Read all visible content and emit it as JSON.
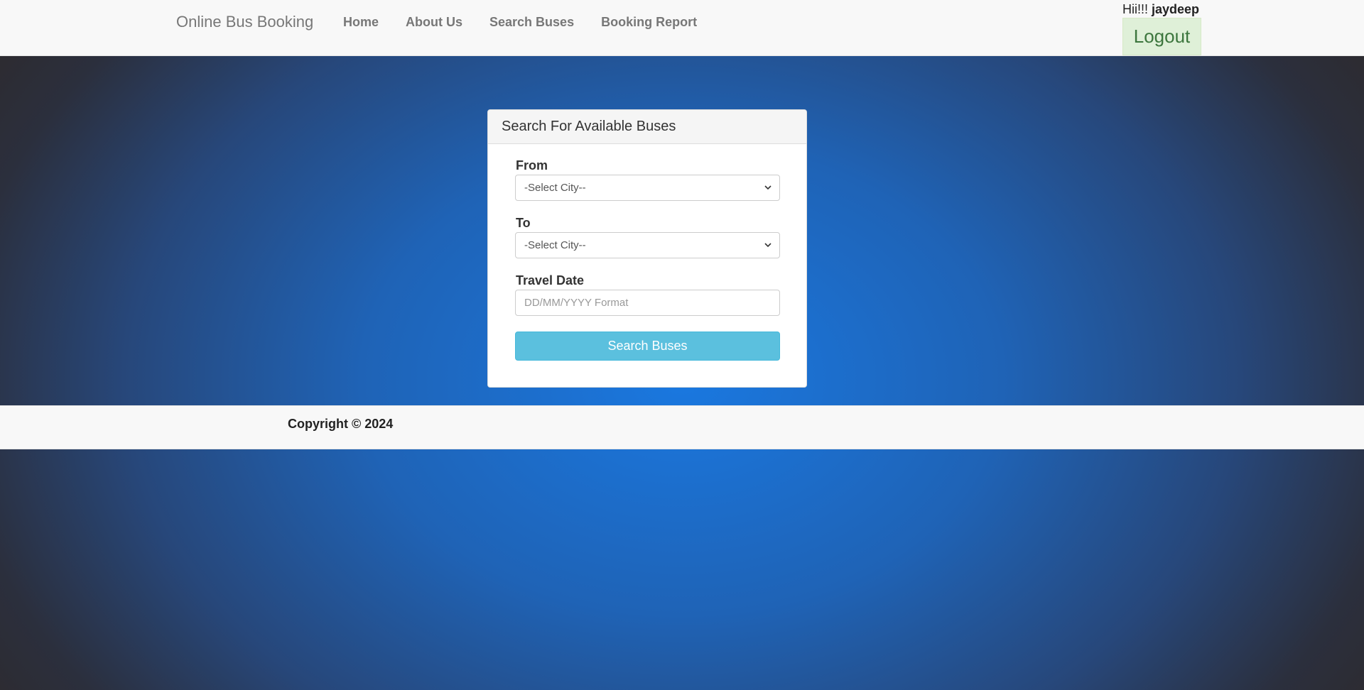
{
  "navbar": {
    "brand": "Online Bus Booking",
    "links": [
      {
        "label": "Home"
      },
      {
        "label": "About Us"
      },
      {
        "label": "Search Buses"
      },
      {
        "label": "Booking Report"
      }
    ],
    "greeting_prefix": "Hii!!! ",
    "username": "jaydeep",
    "logout_label": "Logout"
  },
  "search_panel": {
    "title": "Search For Available Buses",
    "from_label": "From",
    "from_value": "-Select City--",
    "to_label": "To",
    "to_value": "-Select City--",
    "date_label": "Travel Date",
    "date_placeholder": "DD/MM/YYYY Format",
    "date_value": "",
    "submit_label": "Search Buses"
  },
  "footer": {
    "copyright": "Copyright © 2024"
  },
  "colors": {
    "accent_button": "#5bc0de",
    "logout_bg": "#dff0d8",
    "logout_text": "#3c763d",
    "background_center": "#1a78e0",
    "background_edge": "#2e2a2c"
  },
  "icons": {
    "select_arrow": "chevron-down-icon"
  }
}
